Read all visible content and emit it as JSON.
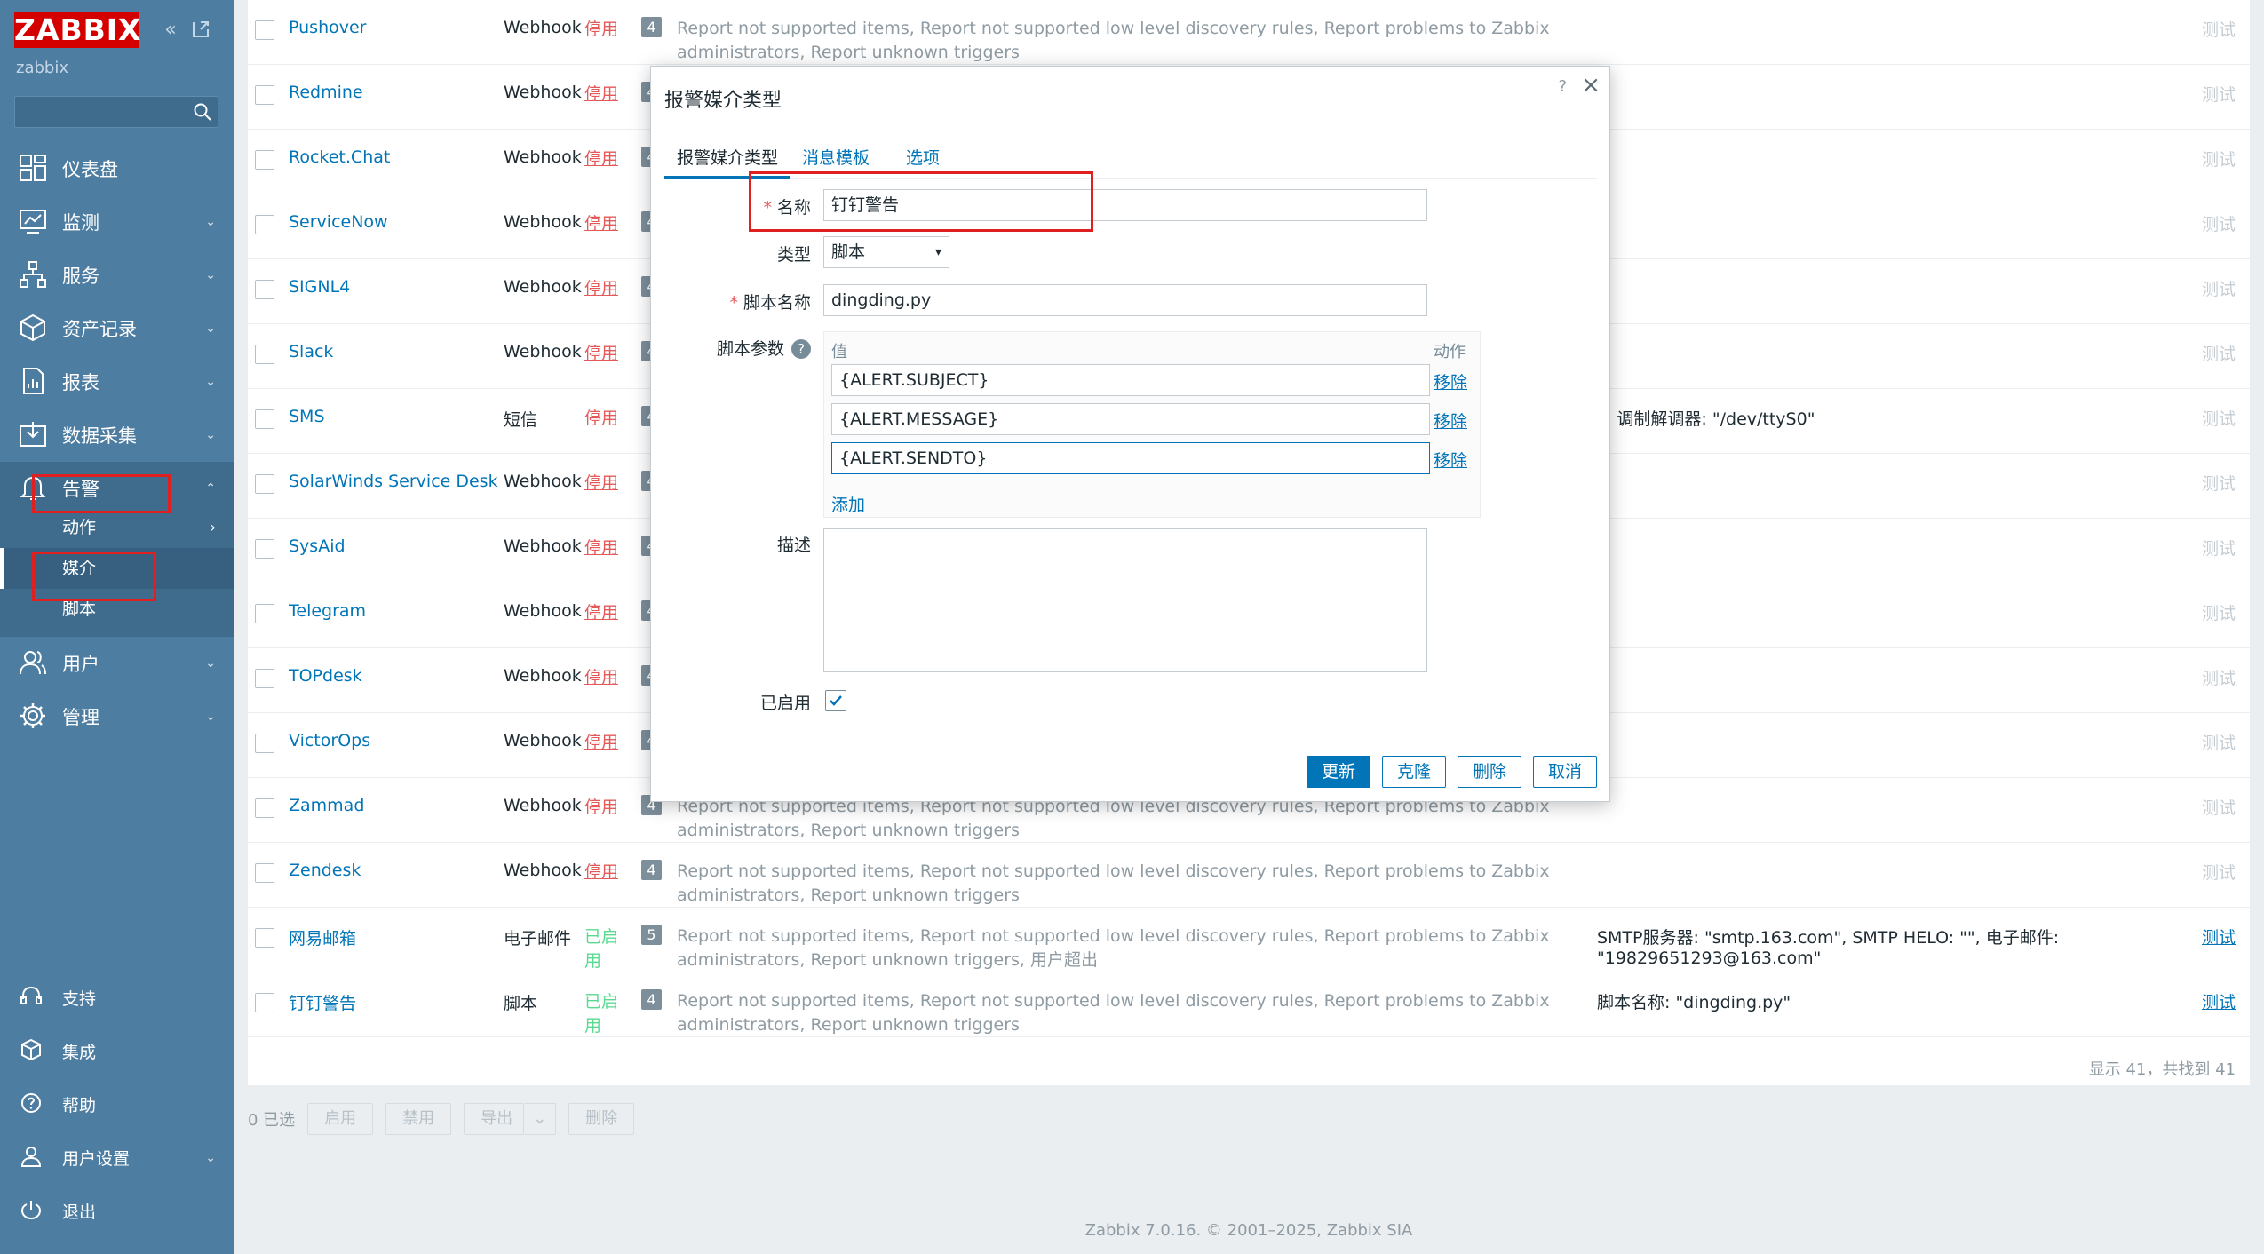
{
  "app": {
    "logo": "ZABBIX",
    "server_name": "zabbix",
    "search_placeholder": ""
  },
  "sidebar": {
    "items": [
      {
        "label": "仪表盘",
        "icon": "dashboard-icon"
      },
      {
        "label": "监测",
        "icon": "monitoring-icon"
      },
      {
        "label": "服务",
        "icon": "services-icon"
      },
      {
        "label": "资产记录",
        "icon": "inventory-icon"
      },
      {
        "label": "报表",
        "icon": "reports-icon"
      },
      {
        "label": "数据采集",
        "icon": "data-collection-icon"
      },
      {
        "label": "告警",
        "icon": "alerts-bell-icon"
      },
      {
        "label": "用户",
        "icon": "users-icon"
      },
      {
        "label": "管理",
        "icon": "administration-gear-icon"
      }
    ],
    "sub_items": [
      {
        "label": "动作"
      },
      {
        "label": "媒介"
      },
      {
        "label": "脚本"
      }
    ],
    "bottom": [
      {
        "label": "支持",
        "icon": "headset-icon"
      },
      {
        "label": "集成",
        "icon": "integrations-icon"
      },
      {
        "label": "帮助",
        "icon": "help-icon"
      },
      {
        "label": "用户设置",
        "icon": "user-settings-icon"
      },
      {
        "label": "退出",
        "icon": "power-icon"
      }
    ]
  },
  "table": {
    "actions_text": "Report not supported items, Report not supported low level discovery rules, Report problems to Zabbix administrators, Report unknown triggers",
    "test_label": "测试",
    "rows": [
      {
        "name": "Pushover",
        "type": "Webhook",
        "status": "停用",
        "count": "4",
        "details": ""
      },
      {
        "name": "Redmine",
        "type": "Webhook",
        "status": "停用",
        "count": "4",
        "details": ""
      },
      {
        "name": "Rocket.Chat",
        "type": "Webhook",
        "status": "停用",
        "count": "4",
        "details": ""
      },
      {
        "name": "ServiceNow",
        "type": "Webhook",
        "status": "停用",
        "count": "4",
        "details": ""
      },
      {
        "name": "SIGNL4",
        "type": "Webhook",
        "status": "停用",
        "count": "4",
        "details": ""
      },
      {
        "name": "Slack",
        "type": "Webhook",
        "status": "停用",
        "count": "4",
        "details": ""
      },
      {
        "name": "SMS",
        "type": "短信",
        "status": "停用",
        "count": "4",
        "details": "M 调制解调器: \"/dev/ttyS0\""
      },
      {
        "name": "SolarWinds Service Desk",
        "type": "Webhook",
        "status": "停用",
        "count": "4",
        "details": ""
      },
      {
        "name": "SysAid",
        "type": "Webhook",
        "status": "停用",
        "count": "4",
        "details": ""
      },
      {
        "name": "Telegram",
        "type": "Webhook",
        "status": "停用",
        "count": "4",
        "details": ""
      },
      {
        "name": "TOPdesk",
        "type": "Webhook",
        "status": "停用",
        "count": "4",
        "details": ""
      },
      {
        "name": "VictorOps",
        "type": "Webhook",
        "status": "停用",
        "count": "4",
        "details": ""
      },
      {
        "name": "Zammad",
        "type": "Webhook",
        "status": "停用",
        "count": "4",
        "details": ""
      },
      {
        "name": "Zendesk",
        "type": "Webhook",
        "status": "停用",
        "count": "4",
        "details": ""
      },
      {
        "name": "网易邮箱",
        "type": "电子邮件",
        "status": "已启用",
        "count": "5",
        "extra_action": "用户超出",
        "details": "SMTP服务器: \"smtp.163.com\", SMTP HELO: \"\", 电子邮件: \"19829651293@163.com\""
      },
      {
        "name": "钉钉警告",
        "type": "脚本",
        "status": "已启用",
        "count": "4",
        "details": "脚本名称: \"dingding.py\""
      }
    ],
    "footer_count": "显示 41，共找到 41"
  },
  "bulk": {
    "selected": "0 已选",
    "enable": "启用",
    "disable": "禁用",
    "export": "导出",
    "delete": "删除"
  },
  "copyright": "Zabbix 7.0.16. © 2001–2025, Zabbix SIA",
  "modal": {
    "title": "报警媒介类型",
    "help": "?",
    "tabs": [
      "报警媒介类型",
      "消息模板",
      "选项"
    ],
    "fields": {
      "name_label": "名称",
      "name_value": "钉钉警告",
      "type_label": "类型",
      "type_value": "脚本",
      "script_label": "脚本名称",
      "script_value": "dingding.py",
      "params_label": "脚本参数",
      "params_value_header": "值",
      "params_action_header": "动作",
      "params": [
        "{ALERT.SUBJECT}",
        "{ALERT.MESSAGE}",
        "{ALERT.SENDTO}"
      ],
      "remove_label": "移除",
      "add_label": "添加",
      "desc_label": "描述",
      "desc_value": "",
      "enabled_label": "已启用"
    },
    "buttons": {
      "update": "更新",
      "clone": "克隆",
      "delete": "删除",
      "cancel": "取消"
    }
  },
  "colors": {
    "sidebar": "#4e7da2",
    "logo": "#d40000",
    "link": "#0275b8",
    "disabled_status": "#e45959",
    "enabled_status": "#59db8f",
    "highlight_box": "#e02020"
  }
}
